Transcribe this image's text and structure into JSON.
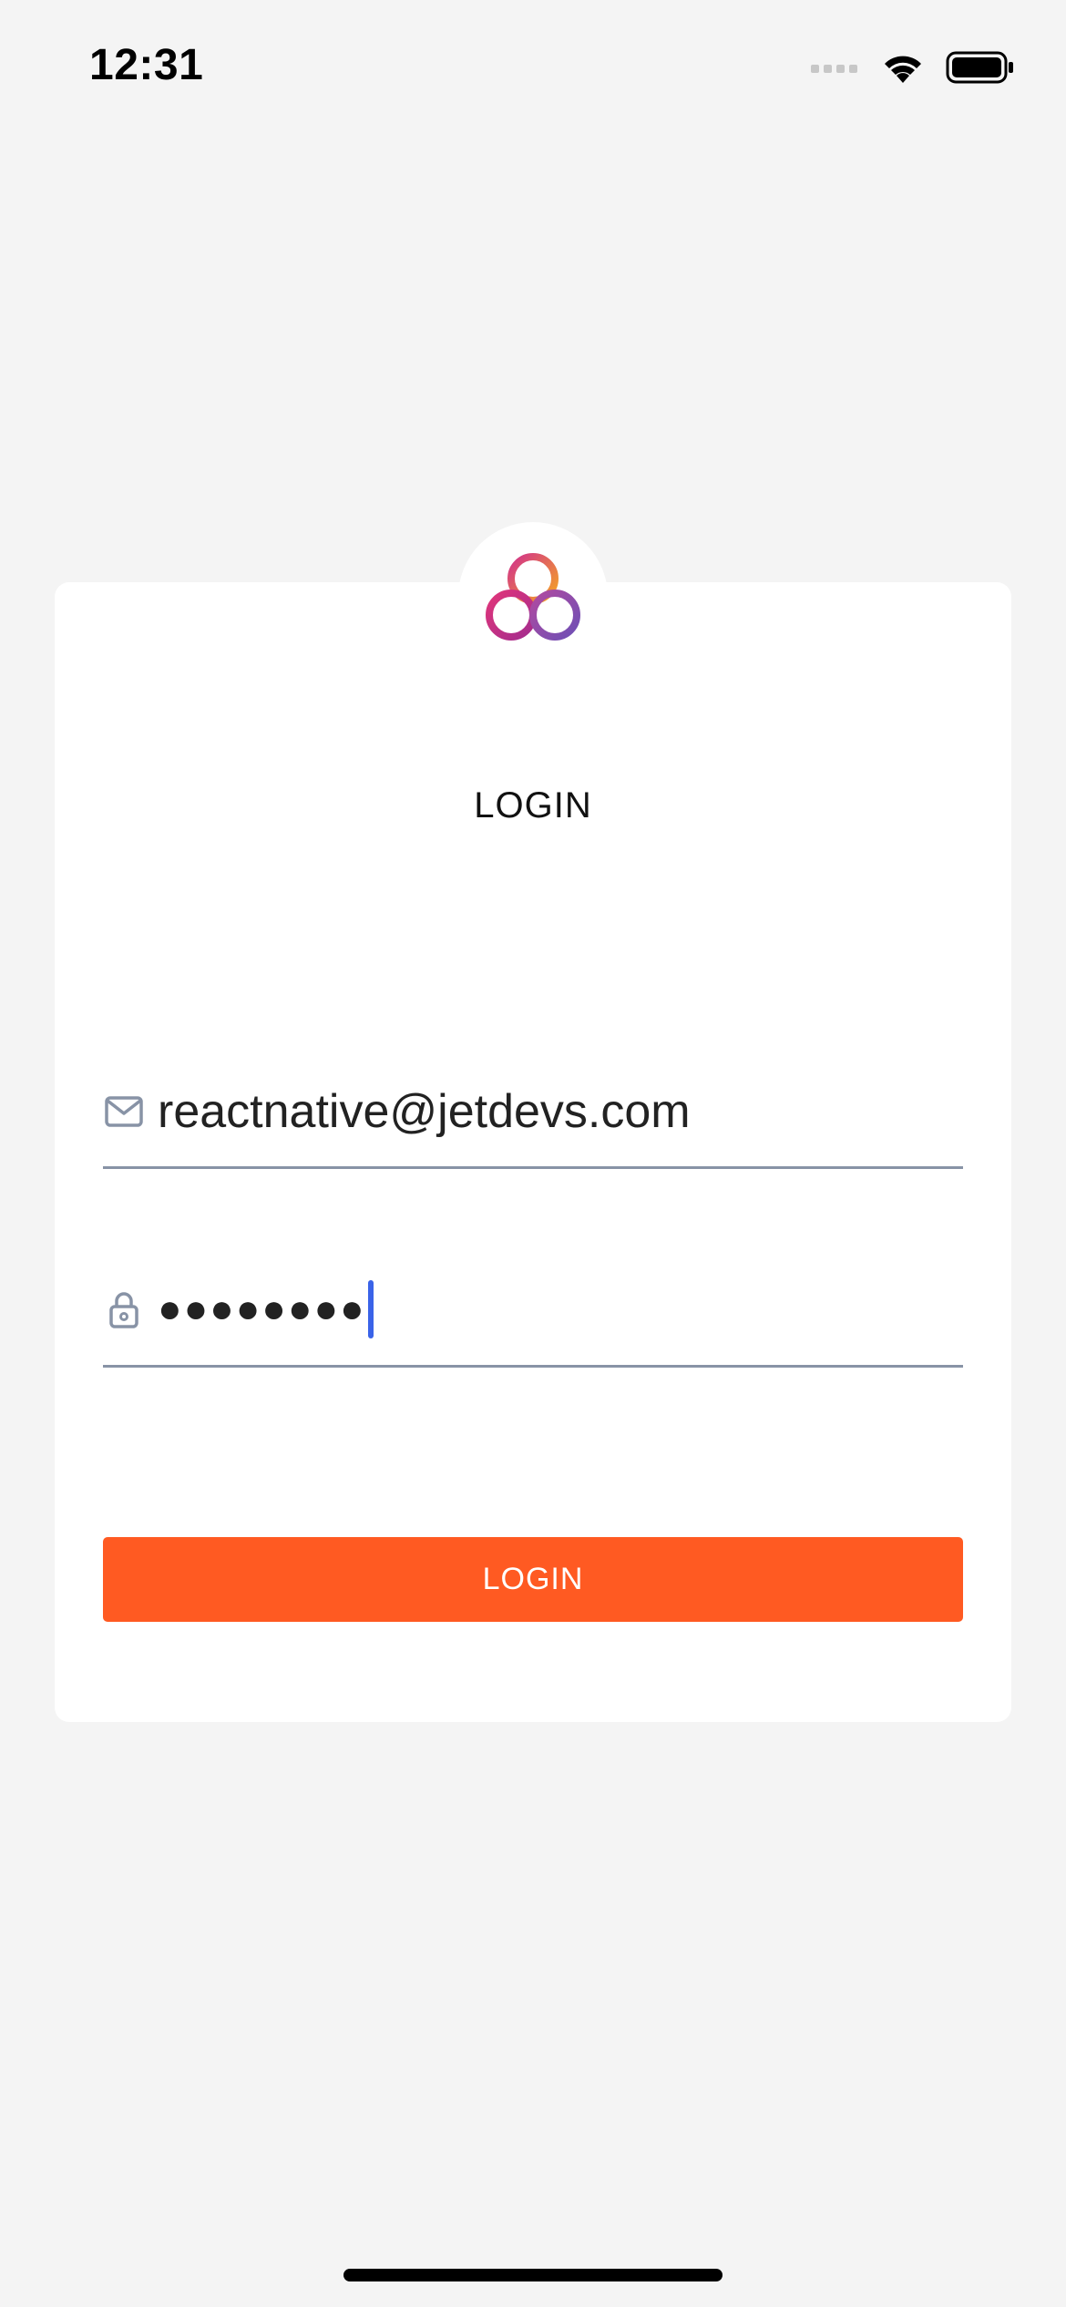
{
  "status_bar": {
    "time": "12:31",
    "icons": [
      "cellular-signal-icon",
      "wifi-icon",
      "battery-icon"
    ]
  },
  "logo": {
    "icon": "interlocked-rings-logo",
    "colors": [
      "#c23a8c",
      "#f5a623",
      "#7e4fb0"
    ]
  },
  "login_card": {
    "title": "LOGIN",
    "email_field": {
      "icon": "mail-icon",
      "value": "reactnative@jetdevs.com"
    },
    "password_field": {
      "icon": "lock-icon",
      "value": "●●●●●●●●"
    },
    "submit_label": "LOGIN"
  },
  "colors": {
    "background": "#f4f4f4",
    "card": "#ffffff",
    "accent_button": "#ff5a22",
    "caret": "#3a63e8",
    "underline": "#8893a6"
  }
}
